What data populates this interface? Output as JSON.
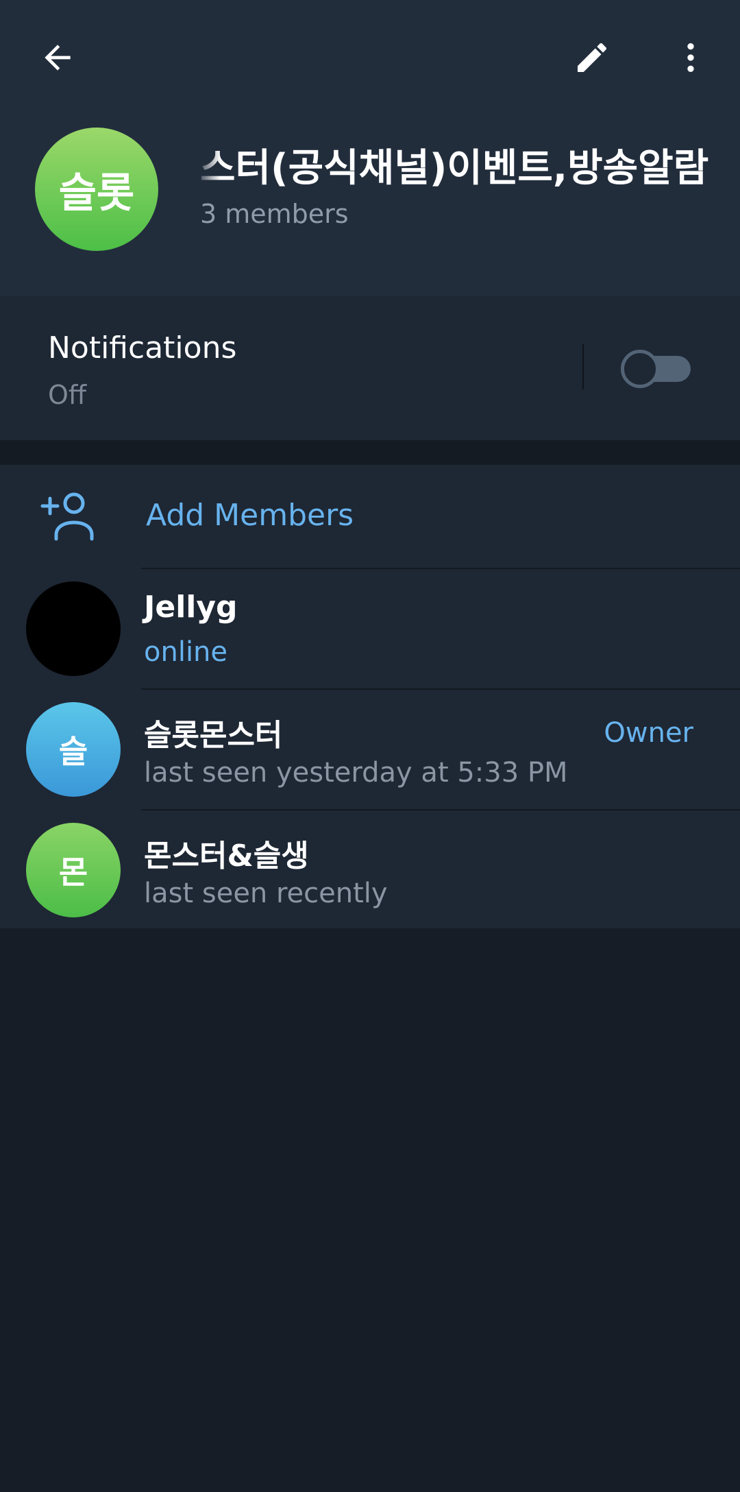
{
  "header": {
    "title": "스터(공식채널)이벤트,방송알람",
    "subtitle": "3 members",
    "avatar_initials": "슬롯",
    "back_icon": "arrow-left-icon",
    "edit_icon": "pencil-icon",
    "more_icon": "more-vertical-icon"
  },
  "notifications": {
    "label": "Notifications",
    "value": "Off",
    "enabled": false
  },
  "members_section": {
    "add_label": "Add Members",
    "add_icon": "add-person-icon",
    "members": [
      {
        "name": "Jellyg",
        "status": "online",
        "role": "",
        "initial": "",
        "avatar_color": "#000000"
      },
      {
        "name": "슬롯몬스터",
        "status": "last seen yesterday at 5:33 PM",
        "role": "Owner",
        "initial": "슬",
        "avatar_color": "#4aaee2"
      },
      {
        "name": "몬스터&슬생",
        "status": "last seen recently",
        "role": "",
        "initial": "몬",
        "avatar_color": "#62c653"
      }
    ]
  },
  "colors": {
    "accent": "#67b3ee",
    "header_bg": "#222d3c",
    "section_bg": "#1e2734",
    "page_bg": "#171d26"
  }
}
